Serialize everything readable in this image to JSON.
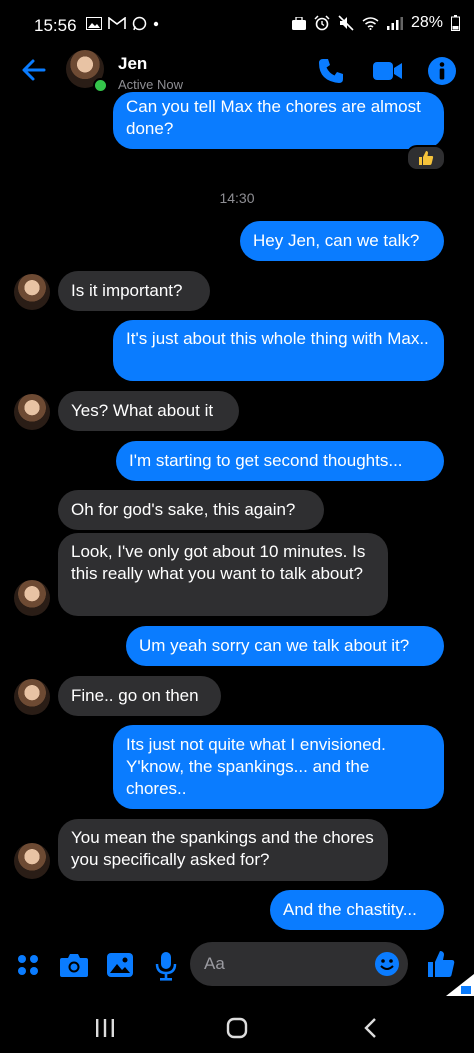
{
  "status_bar": {
    "time": "15:56",
    "battery": "28%"
  },
  "header": {
    "name": "Jen",
    "status": "Active Now"
  },
  "accent_color": "#0a7cff",
  "messages": [
    {
      "from": "me",
      "text": "Can you tell Max the chores are almost done?"
    },
    {
      "from": "me",
      "reaction": "thumbs-up"
    },
    {
      "timestamp": "14:30"
    },
    {
      "from": "me",
      "text": "Hey Jen, can we talk?"
    },
    {
      "from": "jen",
      "text": "Is it important?"
    },
    {
      "from": "me",
      "text": "It's just about this whole thing with Max.."
    },
    {
      "from": "jen",
      "text": "Yes? What about it"
    },
    {
      "from": "me",
      "text": "I'm starting to get second thoughts..."
    },
    {
      "from": "jen",
      "text": "Oh for god's sake, this again?"
    },
    {
      "from": "jen",
      "text": "Look, I've only got about 10 minutes. Is this really what you want to talk about?"
    },
    {
      "from": "me",
      "text": "Um yeah sorry can we talk about it?"
    },
    {
      "from": "jen",
      "text": "Fine.. go on then"
    },
    {
      "from": "me",
      "text": "Its just not quite what I envisioned. Y'know, the spankings... and the chores.."
    },
    {
      "from": "jen",
      "text": "You mean the spankings and the chores you specifically asked for?"
    },
    {
      "from": "me",
      "text": "And the chastity..."
    }
  ],
  "composer": {
    "placeholder": "Aa"
  }
}
